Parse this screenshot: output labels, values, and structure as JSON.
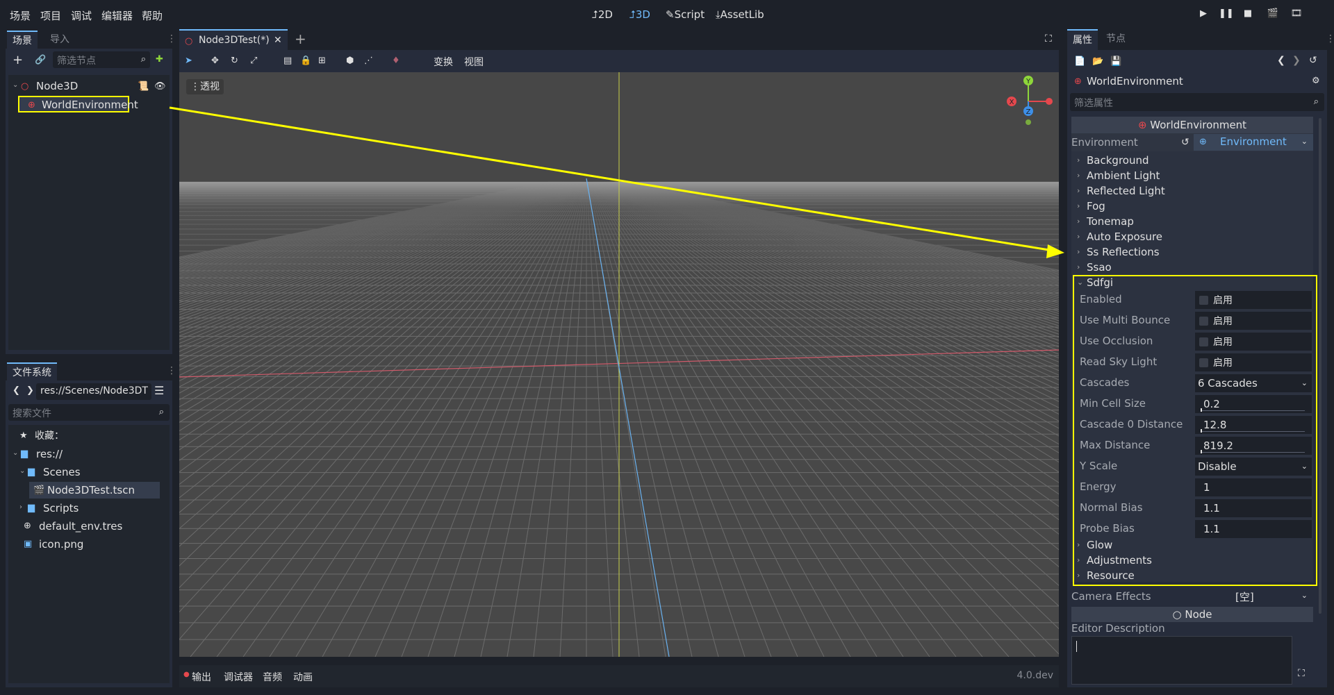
{
  "menu": [
    "场景",
    "项目",
    "调试",
    "编辑器",
    "帮助"
  ],
  "workspaces": [
    {
      "label": "2D",
      "icon": "2d-icon"
    },
    {
      "label": "3D",
      "icon": "3d-icon",
      "active": true
    },
    {
      "label": "Script",
      "icon": "script-icon"
    },
    {
      "label": "AssetLib",
      "icon": "assetlib-icon"
    }
  ],
  "scene_dock": {
    "tabs": [
      "场景",
      "导入"
    ],
    "filter_placeholder": "筛选节点",
    "tree": [
      {
        "label": "Node3D"
      },
      {
        "label": "WorldEnvironment"
      }
    ]
  },
  "filesystem_dock": {
    "tab": "文件系统",
    "path": "res://Scenes/Node3DT",
    "search_placeholder": "搜索文件",
    "tree": [
      {
        "label": "收藏："
      },
      {
        "label": "res://"
      },
      {
        "label": "Scenes"
      },
      {
        "label": "Node3DTest.tscn"
      },
      {
        "label": "Scripts"
      },
      {
        "label": "default_env.tres"
      },
      {
        "label": "icon.png"
      }
    ]
  },
  "editor": {
    "scene_tab": "Node3DTest(*)",
    "toolbar_menus": [
      "变换",
      "视图"
    ],
    "viewport_label": "透视",
    "gizmo": {
      "x": "X",
      "y": "Y",
      "z": "Z"
    }
  },
  "bottom_panel": {
    "tabs": [
      "输出",
      "调试器",
      "音频",
      "动画"
    ],
    "version": "4.0.dev"
  },
  "inspector": {
    "tabs": [
      "属性",
      "节点"
    ],
    "object_name": "WorldEnvironment",
    "filter_placeholder": "筛选属性",
    "section_header": "WorldEnvironment",
    "environment_label": "Environment",
    "environment_value": "Environment",
    "categories": [
      "Background",
      "Ambient Light",
      "Reflected Light",
      "Fog",
      "Tonemap",
      "Auto Exposure",
      "Ss Reflections",
      "Ssao"
    ],
    "sdfgi_label": "Sdfgi",
    "sdfgi_props": [
      {
        "label": "Enabled",
        "value": "启用",
        "kind": "check"
      },
      {
        "label": "Use Multi Bounce",
        "value": "启用",
        "kind": "check"
      },
      {
        "label": "Use Occlusion",
        "value": "启用",
        "kind": "check"
      },
      {
        "label": "Read Sky Light",
        "value": "启用",
        "kind": "check"
      },
      {
        "label": "Cascades",
        "value": "6 Cascades",
        "kind": "select"
      },
      {
        "label": "Min Cell Size",
        "value": "0.2",
        "kind": "slider"
      },
      {
        "label": "Cascade 0 Distance",
        "value": "12.8",
        "kind": "slider"
      },
      {
        "label": "Max Distance",
        "value": "819.2",
        "kind": "slider"
      },
      {
        "label": "Y Scale",
        "value": "Disable",
        "kind": "select"
      },
      {
        "label": "Energy",
        "value": "1",
        "kind": "text"
      },
      {
        "label": "Normal Bias",
        "value": "1.1",
        "kind": "text"
      },
      {
        "label": "Probe Bias",
        "value": "1.1",
        "kind": "text"
      }
    ],
    "after_categories": [
      "Glow",
      "Adjustments",
      "Resource"
    ],
    "camera_effects_label": "Camera Effects",
    "camera_effects_value": "[空]",
    "node_section": "Node",
    "editor_description_label": "Editor Description"
  },
  "colors": {
    "accent": "#70bafa",
    "highlight": "#ffff00",
    "x_axis": "#e5484d",
    "y_axis": "#8ed63a",
    "z_axis": "#3d8fe8"
  }
}
